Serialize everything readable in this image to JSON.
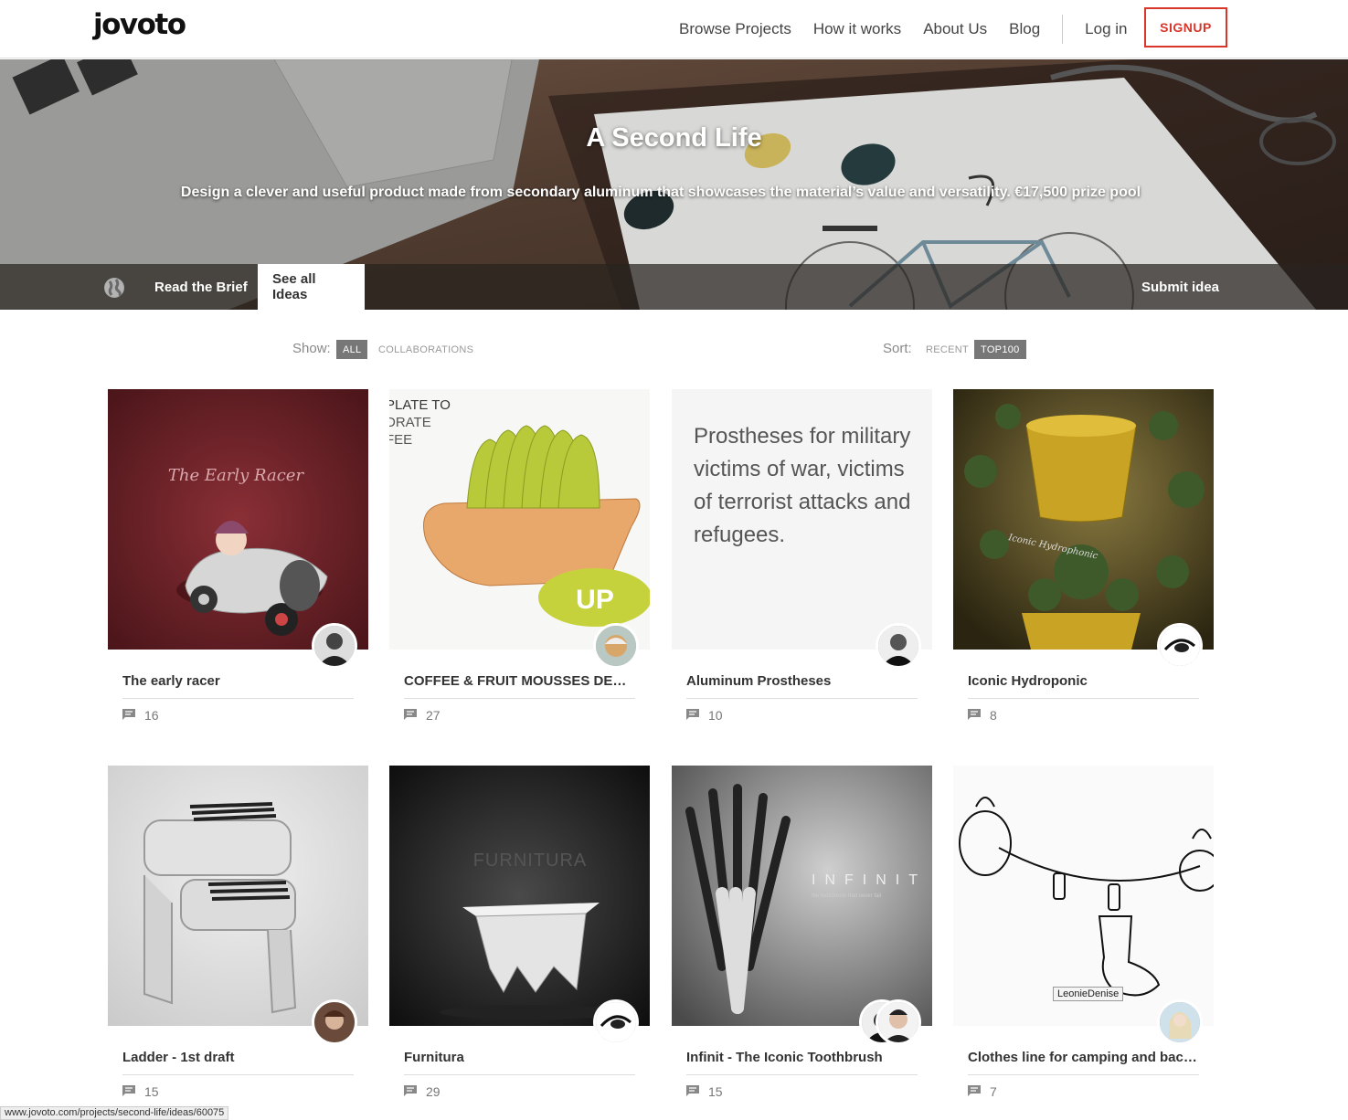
{
  "header": {
    "logo": "jovoto",
    "nav": [
      "Browse Projects",
      "How it works",
      "About Us",
      "Blog"
    ],
    "login": "Log in",
    "signup": "SIGNUP"
  },
  "hero": {
    "title": "A Second Life",
    "subtitle": "Design a clever and useful product made from secondary aluminum that showcases the material’s value and versatility. €17,500 prize pool",
    "tabs": {
      "brief": "Read the Brief",
      "ideas": "See all Ideas"
    },
    "submit": "Submit idea"
  },
  "filters": {
    "show_label": "Show:",
    "show_options": [
      "ALL",
      "COLLABORATIONS"
    ],
    "sort_label": "Sort:",
    "sort_options": [
      "RECENT",
      "TOP100"
    ]
  },
  "cards": [
    {
      "title": "The early racer",
      "comments": "16",
      "thumb_text": "The Early Racer"
    },
    {
      "title": "COFFEE & FRUIT MOUSSES DECORATOR",
      "comments": "27",
      "thumb_text": "PLATE TO\nDRATE\nFEE"
    },
    {
      "title": "Aluminum Prostheses",
      "comments": "10",
      "thumb_text": "Prostheses for military victims of war, victims of terrorist attacks and refugees."
    },
    {
      "title": "Iconic Hydroponic",
      "comments": "8",
      "thumb_text": "Iconic Hydrophonic"
    },
    {
      "title": "Ladder - 1st draft",
      "comments": "15"
    },
    {
      "title": "Furnitura",
      "comments": "29",
      "thumb_text": "FURNITURA"
    },
    {
      "title": "Infinit - The Iconic Toothbrush",
      "comments": "15",
      "thumb_text": "INFINIT",
      "thumb_sub": "the toothbrush that never fail"
    },
    {
      "title": "Clothes line for camping and backpacking",
      "comments": "7"
    }
  ],
  "tooltip": "LeonieDenise",
  "status_url": "www.jovoto.com/projects/second-life/ideas/60075"
}
